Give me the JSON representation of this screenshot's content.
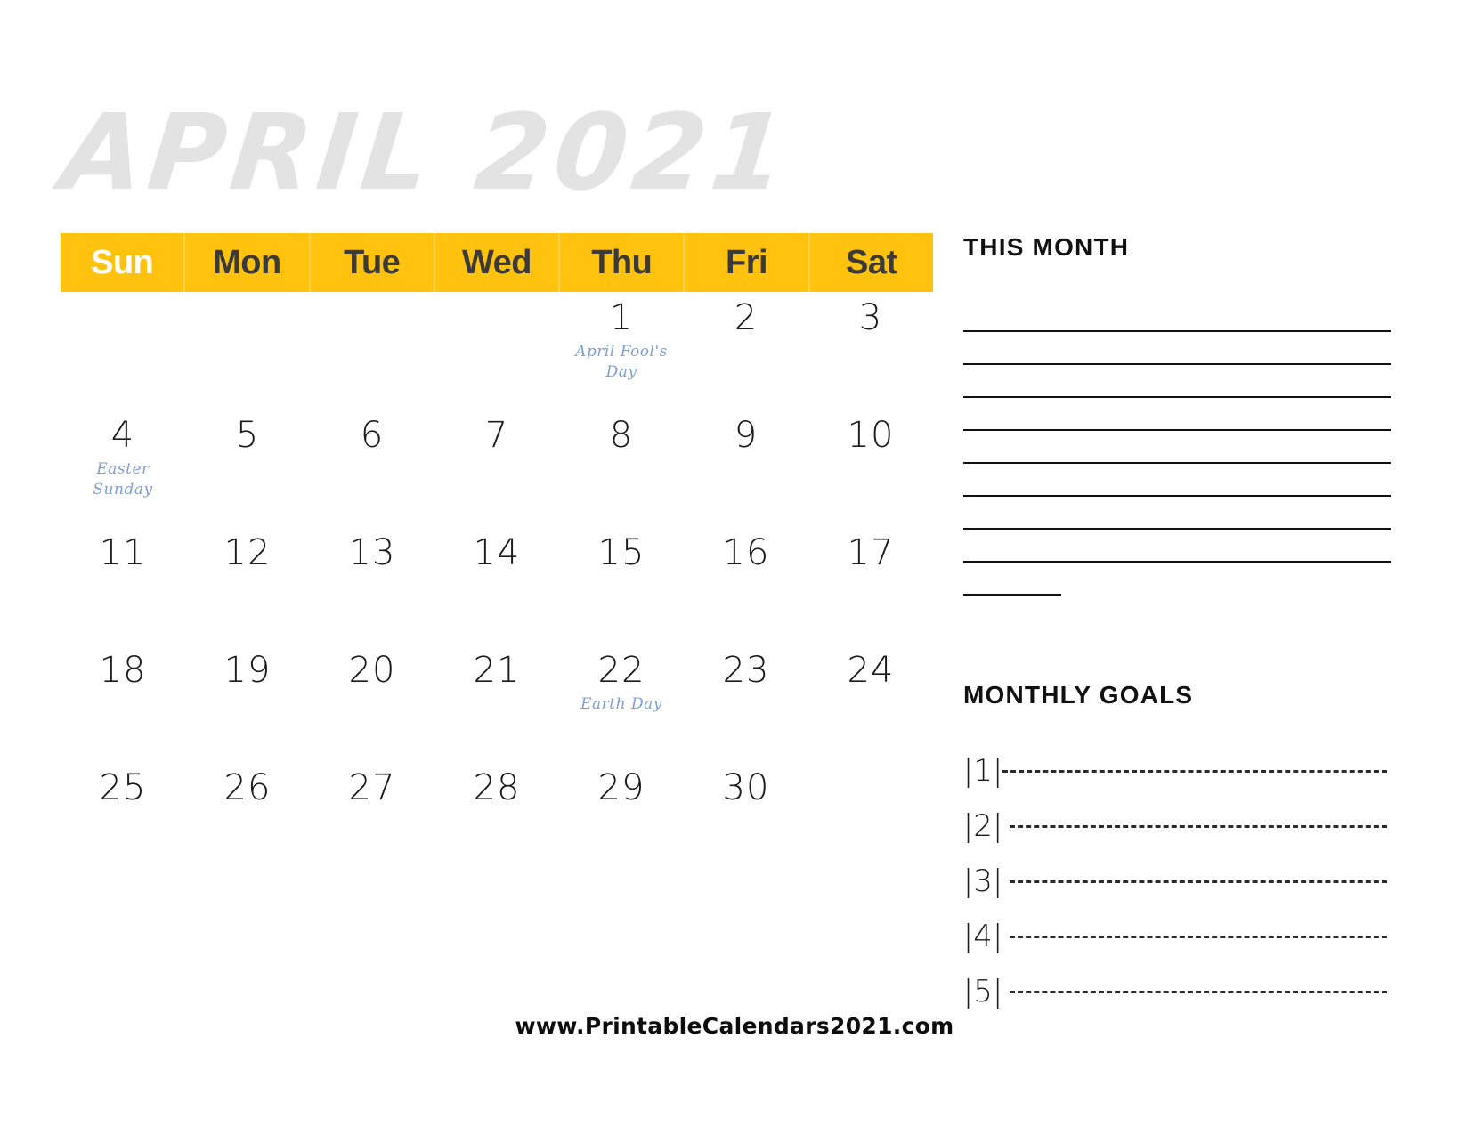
{
  "title": "APRIL 2021",
  "colors": {
    "header_bg": "#FFC20E",
    "title_gray": "#E3E3E3",
    "note_blue": "#7D9FD1",
    "text_dark": "#1B1B1B"
  },
  "weekdays": [
    {
      "label": "Sun",
      "highlight": true
    },
    {
      "label": "Mon",
      "highlight": false
    },
    {
      "label": "Tue",
      "highlight": false
    },
    {
      "label": "Wed",
      "highlight": false
    },
    {
      "label": "Thu",
      "highlight": false
    },
    {
      "label": "Fri",
      "highlight": false
    },
    {
      "label": "Sat",
      "highlight": false
    }
  ],
  "weeks": [
    [
      {
        "num": "",
        "note": ""
      },
      {
        "num": "",
        "note": ""
      },
      {
        "num": "",
        "note": ""
      },
      {
        "num": "",
        "note": ""
      },
      {
        "num": "1",
        "note": "April Fool's Day"
      },
      {
        "num": "2",
        "note": ""
      },
      {
        "num": "3",
        "note": ""
      }
    ],
    [
      {
        "num": "4",
        "note": "Easter Sunday"
      },
      {
        "num": "5",
        "note": ""
      },
      {
        "num": "6",
        "note": ""
      },
      {
        "num": "7",
        "note": ""
      },
      {
        "num": "8",
        "note": ""
      },
      {
        "num": "9",
        "note": ""
      },
      {
        "num": "10",
        "note": ""
      }
    ],
    [
      {
        "num": "11",
        "note": ""
      },
      {
        "num": "12",
        "note": ""
      },
      {
        "num": "13",
        "note": ""
      },
      {
        "num": "14",
        "note": ""
      },
      {
        "num": "15",
        "note": ""
      },
      {
        "num": "16",
        "note": ""
      },
      {
        "num": "17",
        "note": ""
      }
    ],
    [
      {
        "num": "18",
        "note": ""
      },
      {
        "num": "19",
        "note": ""
      },
      {
        "num": "20",
        "note": ""
      },
      {
        "num": "21",
        "note": ""
      },
      {
        "num": "22",
        "note": "Earth Day"
      },
      {
        "num": "23",
        "note": ""
      },
      {
        "num": "24",
        "note": ""
      }
    ],
    [
      {
        "num": "25",
        "note": ""
      },
      {
        "num": "26",
        "note": ""
      },
      {
        "num": "27",
        "note": ""
      },
      {
        "num": "28",
        "note": ""
      },
      {
        "num": "29",
        "note": ""
      },
      {
        "num": "30",
        "note": ""
      },
      {
        "num": "",
        "note": ""
      }
    ]
  ],
  "this_month": {
    "heading": "THIS MONTH",
    "line_count": 8,
    "has_short_last_line": true
  },
  "monthly_goals": {
    "heading": "MONTHLY GOALS",
    "items": [
      {
        "number": "1"
      },
      {
        "number": "2"
      },
      {
        "number": "3"
      },
      {
        "number": "4"
      },
      {
        "number": "5"
      }
    ]
  },
  "footer": {
    "url": "www.PrintableCalendars2021.com"
  }
}
